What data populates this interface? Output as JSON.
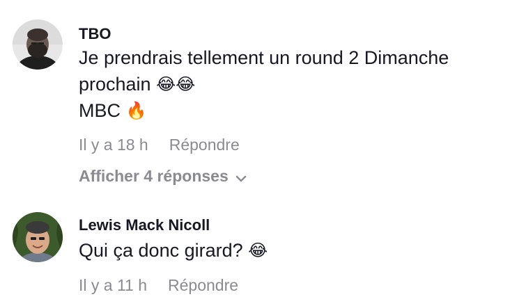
{
  "comments": [
    {
      "author": "TBO",
      "lines": [
        "Je prendrais tellement un round 2 Dimanche",
        "prochain",
        "MBC"
      ],
      "emojis": {
        "laugh": "😂😂",
        "fire": "🔥"
      },
      "timestamp": "Il y a 18 h",
      "reply_label": "Répondre",
      "view_replies_label": "Afficher 4 réponses"
    },
    {
      "author": "Lewis Mack Nicoll",
      "lines": [
        "Qui ça donc girard?"
      ],
      "emojis": {
        "laugh": "😂"
      },
      "timestamp": "Il y a 11 h",
      "reply_label": "Répondre"
    }
  ],
  "colors": {
    "text": "#161823",
    "muted": "#8a8b91",
    "background": "#ffffff"
  },
  "icons": {
    "view_replies": "chevron-down-icon"
  }
}
